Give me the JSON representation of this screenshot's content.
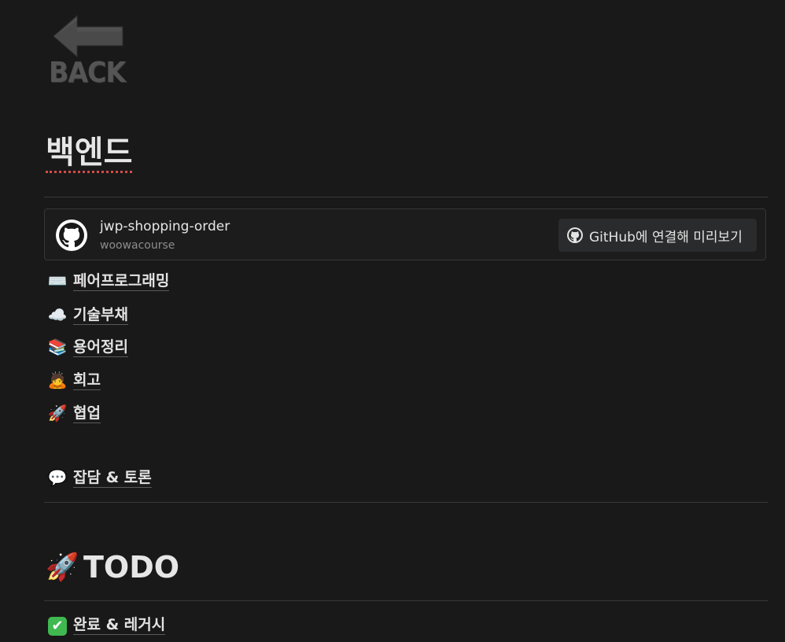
{
  "back": {
    "text": "BACK",
    "arrow_color": "#4a4a4a"
  },
  "page": {
    "title": "백엔드"
  },
  "github_card": {
    "repo": "jwp-shopping-order",
    "owner": "woowacourse",
    "connect_label": "GitHub에 연결해 미리보기",
    "icon": "github-icon"
  },
  "links": [
    {
      "emoji": "⌨️",
      "icon": "keyboard-icon",
      "label": "페어프로그래밍"
    },
    {
      "emoji": "☁️",
      "icon": "cloud-icon",
      "label": "기술부채"
    },
    {
      "emoji": "📚",
      "icon": "books-icon",
      "label": "용어정리"
    },
    {
      "emoji": "🙇",
      "icon": "bowing-person-icon",
      "label": "회고"
    },
    {
      "emoji": "🚀",
      "icon": "rocket-icon",
      "label": "협업"
    },
    {
      "emoji": "💬",
      "icon": "speech-bubble-icon",
      "label": "잡담 & 토론"
    }
  ],
  "todo": {
    "emoji": "🚀",
    "icon": "rocket-icon",
    "title": "TODO",
    "items": [
      {
        "emoji": "✔",
        "icon": "check-mark-icon",
        "label": "완료 & 레거시"
      }
    ]
  },
  "colors": {
    "background": "#191919",
    "text": "#e3e3e3",
    "divider": "#373737",
    "spellcheck": "#d44c47",
    "check_green": "#3fb950"
  }
}
